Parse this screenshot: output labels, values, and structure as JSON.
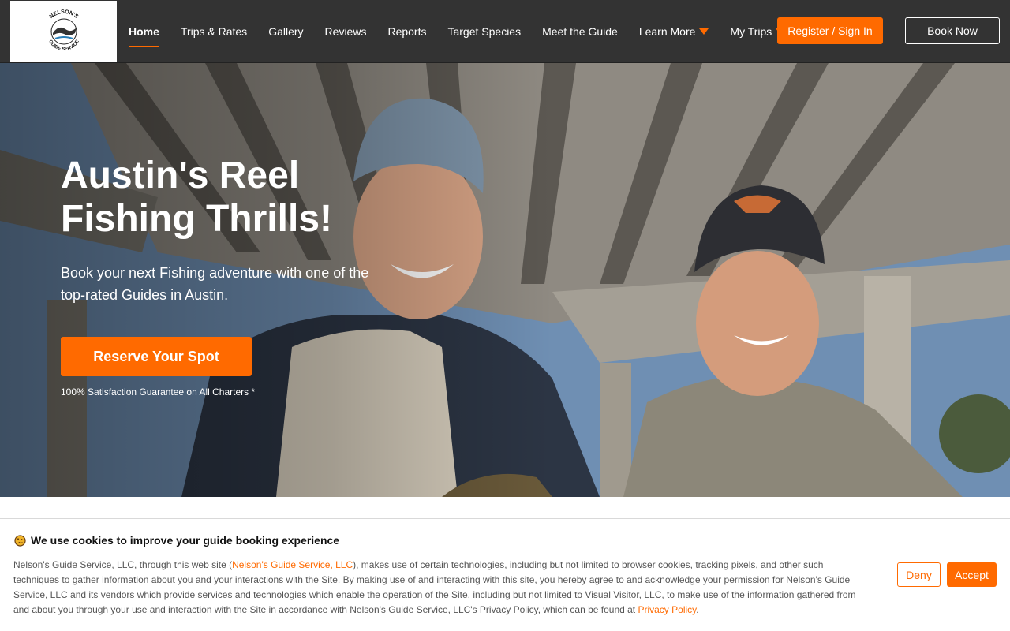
{
  "nav": {
    "logo_icon": "nelsons-guide-service-logo",
    "logo_text_top": "NELSON'S",
    "logo_text_bottom": "GUIDE SERVICE",
    "links": [
      {
        "label": "Home",
        "active": true
      },
      {
        "label": "Trips & Rates"
      },
      {
        "label": "Gallery"
      },
      {
        "label": "Reviews"
      },
      {
        "label": "Reports"
      },
      {
        "label": "Target Species"
      },
      {
        "label": "Meet the Guide"
      },
      {
        "label": "Learn More",
        "dropdown": true
      },
      {
        "label": "My Trips",
        "dropdown": true
      }
    ],
    "register_label": "Register / Sign In",
    "book_label": "Book Now"
  },
  "hero": {
    "title_line1": "Austin's Reel",
    "title_line2": "Fishing Thrills!",
    "subtitle_line1": "Book your next Fishing adventure with one of the",
    "subtitle_line2": "top-rated Guides in Austin.",
    "cta_label": "Reserve Your Spot",
    "guarantee": "100% Satisfaction Guarantee on All Charters *",
    "image": "two-men-smiling-under-bridge-photo"
  },
  "cookie": {
    "icon": "cookie-icon",
    "title": "We use cookies to improve your guide booking experience",
    "text_before_link": "Nelson's Guide Service, LLC, through this web site (",
    "site_link": "Nelson's Guide Service, LLC",
    "text_after_link": "), makes use of certain technologies, including but not limited to browser cookies, tracking pixels, and other such techniques to gather information about you and your interactions with the Site. By making use of and interacting with this site, you hereby agree to and acknowledge your permission for Nelson's Guide Service, LLC and its vendors which provide services and technologies which enable the operation of the Site, including but not limited to Visual Visitor, LLC, to make use of the information gathered from and about you through your use and interaction with the Site in accordance with Nelson's Guide Service, LLC's Privacy Policy, which can be found at ",
    "privacy_link": "Privacy Policy",
    "text_end": ".",
    "deny_label": "Deny",
    "accept_label": "Accept"
  },
  "colors": {
    "accent": "#ff6a00",
    "navbar": "#333333"
  }
}
